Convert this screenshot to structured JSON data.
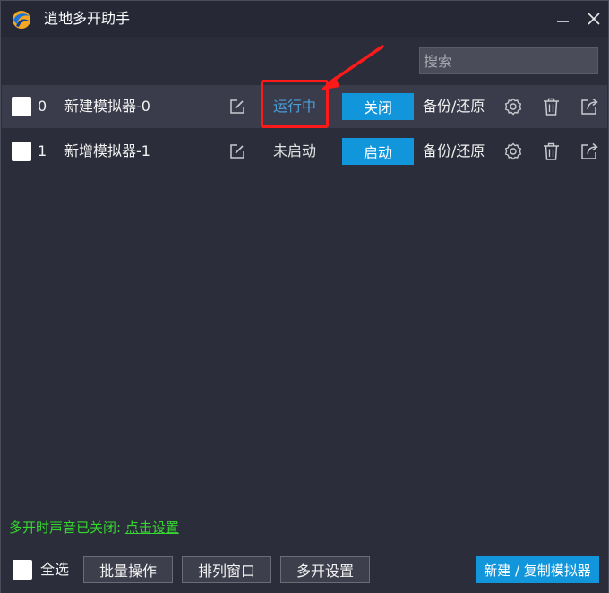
{
  "window": {
    "title": "逍地多开助手",
    "icon": "app-logo-icon",
    "minimize_icon": "minimize-icon",
    "close_icon": "close-icon"
  },
  "search": {
    "placeholder": "搜索",
    "value": ""
  },
  "emulators": [
    {
      "index": "0",
      "name": "新建模拟器-0",
      "status": "运行中",
      "action": "关闭",
      "backup": "备份/还原",
      "selected": true,
      "checked": false
    },
    {
      "index": "1",
      "name": "新增模拟器-1",
      "status": "未启动",
      "action": "启动",
      "backup": "备份/还原",
      "selected": false,
      "checked": false
    }
  ],
  "notice": {
    "text": "多开时声音已关闭: ",
    "link": "点击设置"
  },
  "footer": {
    "select_all": "全选",
    "batch": "批量操作",
    "arrange": "排列窗口",
    "settings": "多开设置",
    "new_copy": "新建 / 复制模拟器"
  },
  "colors": {
    "background": "#2b2d3a",
    "titlebar": "#262836",
    "selected_row": "#3a3c4b",
    "accent": "#1296db",
    "running": "#4b9fdc",
    "notice": "#35d82e",
    "highlight": "#ff1a1a"
  }
}
